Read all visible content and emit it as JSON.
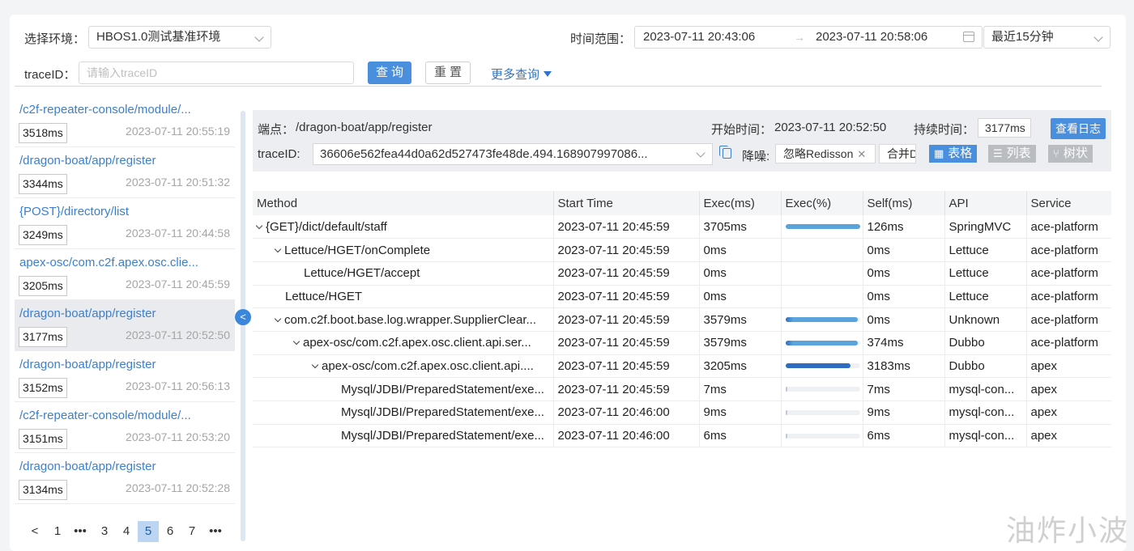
{
  "filters": {
    "env_label": "选择环境：",
    "env_value": "HBOS1.0测试基准环境",
    "time_label": "时间范围：",
    "time_start": "2023-07-11 20:43:06",
    "time_end": "2023-07-11 20:58:06",
    "quick_range": "最近15分钟",
    "traceid_label": "traceID：",
    "traceid_placeholder": "请输入traceID",
    "query_btn": "查询",
    "reset_btn": "重置",
    "more_query": "更多查询"
  },
  "list": [
    {
      "path": "/c2f-repeater-console/module/...",
      "duration": "3518ms",
      "time": "2023-07-11 20:55:19"
    },
    {
      "path": "/dragon-boat/app/register",
      "duration": "3344ms",
      "time": "2023-07-11 20:51:32"
    },
    {
      "path": "{POST}/directory/list",
      "duration": "3249ms",
      "time": "2023-07-11 20:44:58"
    },
    {
      "path": "apex-osc/com.c2f.apex.osc.clie...",
      "duration": "3205ms",
      "time": "2023-07-11 20:45:59"
    },
    {
      "path": "/dragon-boat/app/register",
      "duration": "3177ms",
      "time": "2023-07-11 20:52:50"
    },
    {
      "path": "/dragon-boat/app/register",
      "duration": "3152ms",
      "time": "2023-07-11 20:56:13"
    },
    {
      "path": "/c2f-repeater-console/module/...",
      "duration": "3151ms",
      "time": "2023-07-11 20:53:20"
    },
    {
      "path": "/dragon-boat/app/register",
      "duration": "3134ms",
      "time": "2023-07-11 20:52:28"
    }
  ],
  "list_active_index": 4,
  "pagination": {
    "prev": "<",
    "pages": [
      "1",
      "•••",
      "3",
      "4",
      "5",
      "6",
      "7",
      "•••"
    ],
    "current": "5"
  },
  "detail": {
    "endpoint_label": "端点：",
    "endpoint": "/dragon-boat/app/register",
    "start_label": "开始时间：",
    "start_time": "2023-07-11 20:52:50",
    "duration_label": "持续时间：",
    "duration": "3177ms",
    "view_log": "查看日志",
    "traceid_label": "traceID:",
    "traceid": "36606e562fea44d0a62d527473fe48de.494.168907997086...",
    "denoise_label": "降噪:",
    "tags": [
      "忽略Redisson",
      "合并D"
    ],
    "views": [
      "表格",
      "列表",
      "树状"
    ]
  },
  "table": {
    "columns": [
      "Method",
      "Start Time",
      "Exec(ms)",
      "Exec(%)",
      "Self(ms)",
      "API",
      "Service"
    ],
    "rows": [
      {
        "indent": 0,
        "caret": true,
        "method": "{GET}/dict/default/staff",
        "start": "2023-07-11 20:45:59",
        "exec": "3705ms",
        "pct": 100,
        "self": "126ms",
        "api": "SpringMVC",
        "service": "ace-platform"
      },
      {
        "indent": 1,
        "caret": true,
        "method": "Lettuce/HGET/onComplete",
        "start": "2023-07-11 20:45:59",
        "exec": "0ms",
        "pct": 0,
        "self": "0ms",
        "api": "Lettuce",
        "service": "ace-platform"
      },
      {
        "indent": 2,
        "caret": false,
        "method": "Lettuce/HGET/accept",
        "start": "2023-07-11 20:45:59",
        "exec": "0ms",
        "pct": 0,
        "self": "0ms",
        "api": "Lettuce",
        "service": "ace-platform"
      },
      {
        "indent": 1,
        "caret": false,
        "method": "Lettuce/HGET",
        "start": "2023-07-11 20:45:59",
        "exec": "0ms",
        "pct": 0,
        "self": "0ms",
        "api": "Lettuce",
        "service": "ace-platform"
      },
      {
        "indent": 1,
        "caret": true,
        "method": "com.c2f.boot.base.log.wrapper.SupplierClear...",
        "start": "2023-07-11 20:45:59",
        "exec": "3579ms",
        "pct": 97,
        "self": "0ms",
        "api": "Unknown",
        "service": "ace-platform"
      },
      {
        "indent": 2,
        "caret": true,
        "method": "apex-osc/com.c2f.apex.osc.client.api.ser...",
        "start": "2023-07-11 20:45:59",
        "exec": "3579ms",
        "pct": 97,
        "self": "374ms",
        "api": "Dubbo",
        "service": "ace-platform"
      },
      {
        "indent": 3,
        "caret": true,
        "method": "apex-osc/com.c2f.apex.osc.client.api....",
        "start": "2023-07-11 20:45:59",
        "exec": "3205ms",
        "pct": 87,
        "self": "3183ms",
        "api": "Dubbo",
        "service": "apex"
      },
      {
        "indent": 4,
        "caret": false,
        "method": "Mysql/JDBI/PreparedStatement/exe...",
        "start": "2023-07-11 20:45:59",
        "exec": "7ms",
        "pct": 1,
        "self": "7ms",
        "api": "mysql-con...",
        "service": "apex"
      },
      {
        "indent": 4,
        "caret": false,
        "method": "Mysql/JDBI/PreparedStatement/exe...",
        "start": "2023-07-11 20:46:00",
        "exec": "9ms",
        "pct": 1,
        "self": "9ms",
        "api": "mysql-con...",
        "service": "apex"
      },
      {
        "indent": 4,
        "caret": false,
        "method": "Mysql/JDBI/PreparedStatement/exe...",
        "start": "2023-07-11 20:46:00",
        "exec": "6ms",
        "pct": 1,
        "self": "6ms",
        "api": "mysql-con...",
        "service": "apex"
      }
    ]
  },
  "colors": {
    "accent": "#4a8fdd",
    "link": "#3b7fce",
    "bar_light": "#5aa3db",
    "bar_dark": "#2d6cc0"
  },
  "watermark": "油炸小波"
}
